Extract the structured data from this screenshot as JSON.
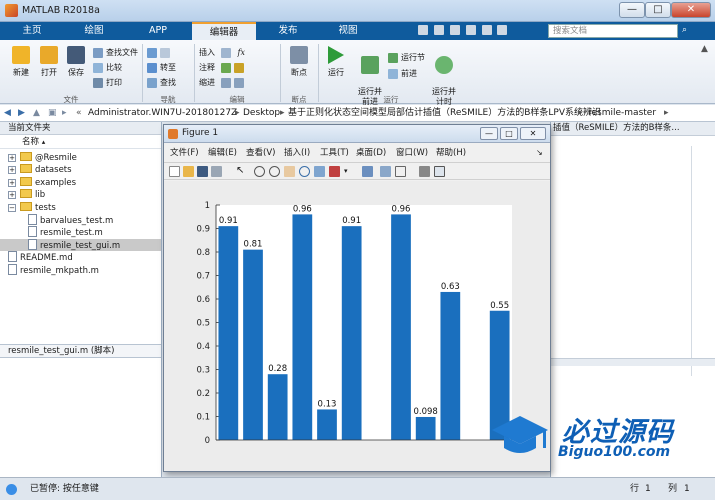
{
  "window": {
    "title": "MATLAB R2018a",
    "min": "—",
    "max": "□",
    "close": "✕"
  },
  "tabs": [
    "主页",
    "绘图",
    "APP",
    "编辑器",
    "发布",
    "视图"
  ],
  "search_placeholder": "搜索文档",
  "ribbon": {
    "file": {
      "new": "新建",
      "open": "打开",
      "save": "保存",
      "find_files": "查找文件",
      "compare": "比较",
      "print": "打印",
      "group": "文件"
    },
    "nav": {
      "goto": "转至",
      "find": "查找",
      "group": "导航"
    },
    "edit": {
      "insert": "插入",
      "comment": "注释",
      "indent": "缩进",
      "fx": "fx",
      "group": "编辑"
    },
    "breakpoints": {
      "label": "断点",
      "group": "断点"
    },
    "run": {
      "run": "运行",
      "run_advance": "运行并\n前进",
      "run_section": "运行节",
      "advance": "前进",
      "run_time": "运行并\n计时",
      "group": "运行"
    }
  },
  "address": {
    "path": [
      "Administrator.WIN7U-20180127Z",
      "Desktop",
      "基于正则化状态空间模型局部估计插值（ReSMILE）方法的B样条LPV系统辨识",
      "resmile-master"
    ]
  },
  "current_folder": {
    "title": "当前文件夹",
    "col_name": "名称",
    "items": [
      {
        "name": "@Resmile",
        "kind": "folder",
        "level": 0
      },
      {
        "name": "datasets",
        "kind": "folder",
        "level": 0
      },
      {
        "name": "examples",
        "kind": "folder",
        "level": 0
      },
      {
        "name": "lib",
        "kind": "folder",
        "level": 0
      },
      {
        "name": "tests",
        "kind": "folder",
        "level": 0,
        "expanded": true
      },
      {
        "name": "barvalues_test.m",
        "kind": "m",
        "level": 1
      },
      {
        "name": "resmile_test.m",
        "kind": "m",
        "level": 1
      },
      {
        "name": "resmile_test_gui.m",
        "kind": "m",
        "level": 1,
        "selected": true
      },
      {
        "name": "README.md",
        "kind": "file",
        "level": 0
      },
      {
        "name": "resmile_mkpath.m",
        "kind": "m",
        "level": 0
      }
    ],
    "details": "resmile_test_gui.m  (脚本)"
  },
  "right_panel_text": "插值（ReSMILE）方法的B样条...",
  "figure": {
    "title": "Figure 1",
    "menus": [
      "文件(F)",
      "编辑(E)",
      "查看(V)",
      "插入(I)",
      "工具(T)",
      "桌面(D)",
      "窗口(W)",
      "帮助(H)"
    ]
  },
  "chart_data": {
    "type": "bar",
    "x": [
      1,
      2,
      3,
      4,
      5,
      6,
      7,
      8,
      9,
      10,
      11,
      12
    ],
    "values": [
      0.91,
      0.81,
      0.28,
      0.96,
      0.13,
      0.91,
      null,
      0.96,
      0.098,
      0.63,
      null,
      0.55
    ],
    "labels": [
      "0.91",
      "0.81",
      "0.28",
      "0.96",
      "0.13",
      "0.91",
      "",
      "0.96",
      "0.098",
      "0.63",
      "",
      "0.55"
    ],
    "ylim": [
      0,
      1
    ],
    "yticks": [
      "0",
      "0.1",
      "0.2",
      "0.3",
      "0.4",
      "0.5",
      "0.6",
      "0.7",
      "0.8",
      "0.9",
      "1"
    ],
    "bar_color": "#1a6fbe",
    "title": "",
    "xlabel": "",
    "ylabel": ""
  },
  "status": {
    "text": "已暂停: 按任意键",
    "line_label": "行",
    "line": "1",
    "col_label": "列",
    "col": "1"
  },
  "logo": {
    "cn": "必过源码",
    "url": "Biguo100.com"
  },
  "accent": "#0f5b9d"
}
